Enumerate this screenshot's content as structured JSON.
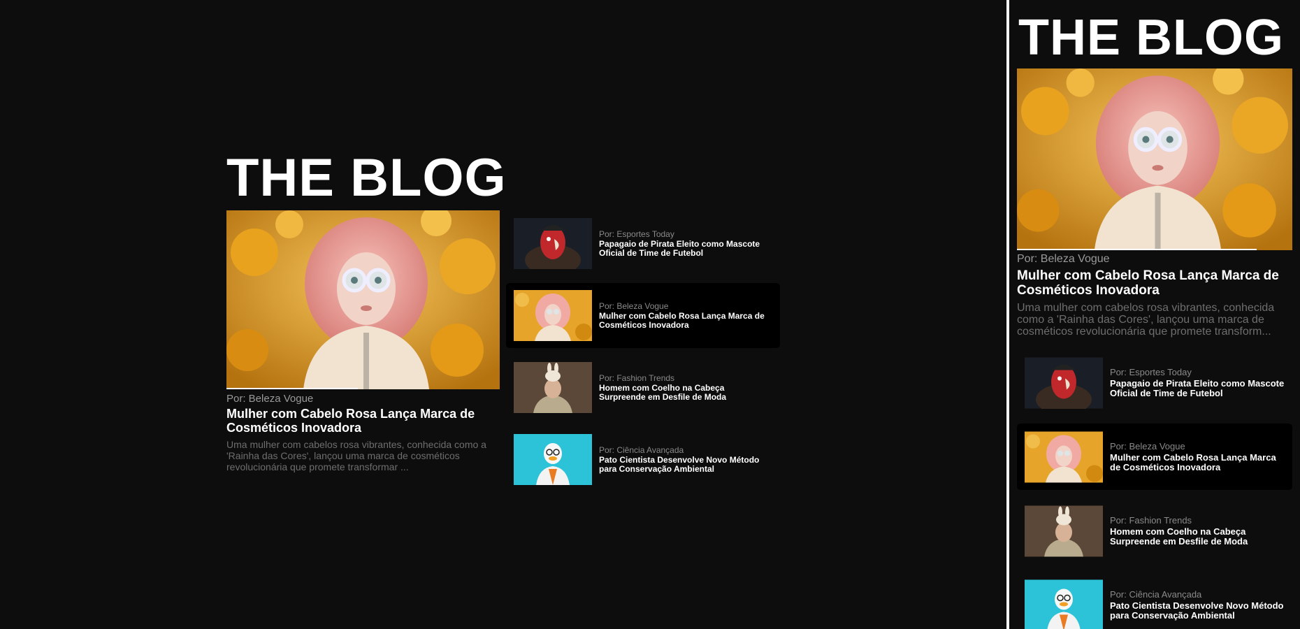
{
  "blog": {
    "title": "THE BLOG"
  },
  "featured": {
    "author": "Por: Beleza Vogue",
    "title": "Mulher com Cabelo Rosa Lança Marca de Cosméticos Inovadora",
    "excerpt": "Uma mulher com cabelos rosa vibrantes, conhecida como a 'Rainha das Cores', lançou uma marca de cosméticos revolucionária que promete transformar ...",
    "image_icon": "pink-hair-woman-image",
    "progress": 0.48
  },
  "mobile_featured": {
    "excerpt": "Uma mulher com cabelos rosa vibrantes, conhecida como a 'Rainha das Cores', lançou uma marca de cosméticos revolucionária que promete transform...",
    "progress": 0.87
  },
  "posts": [
    {
      "author": "Por: Esportes Today",
      "title": "Papagaio de Pirata Eleito como Mascote Oficial de Time de Futebol",
      "image_icon": "pirate-parrot-image",
      "active": false
    },
    {
      "author": "Por: Beleza Vogue",
      "title": "Mulher com Cabelo Rosa Lança Marca de Cosméticos Inovadora",
      "image_icon": "pink-hair-woman-image",
      "active": true
    },
    {
      "author": "Por: Fashion Trends",
      "title": "Homem com Coelho na Cabeça Surpreende em Desfile de Moda",
      "image_icon": "man-with-rabbit-image",
      "active": false
    },
    {
      "author": "Por: Ciência Avançada",
      "title": "Pato Cientista Desenvolve Novo Método para Conservação Ambiental",
      "image_icon": "scientist-duck-image",
      "active": false
    }
  ],
  "colors": {
    "background": "#0d0d0d",
    "active_card": "#000000",
    "divider": "#f2f2f2",
    "muted_text": "#9a9a9a"
  }
}
